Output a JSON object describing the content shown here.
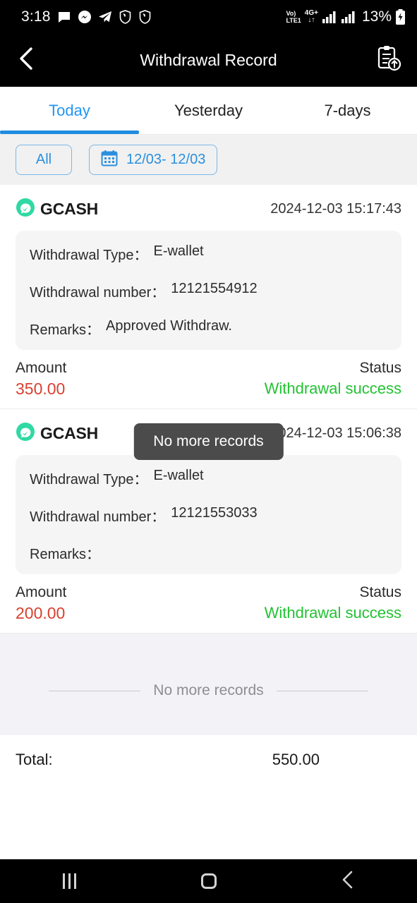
{
  "status_bar": {
    "clock": "3:18",
    "left_icons": [
      "message-bubble-icon",
      "messenger-icon",
      "telegram-icon",
      "shield-icon",
      "shield-icon"
    ],
    "volte_line1": "Vo)",
    "volte_line2": "LTE1",
    "network_type": "4G+",
    "data_arrows": "↓↑",
    "battery_percent": "13%",
    "battery_state": "charging"
  },
  "header": {
    "back_icon": "chevron-left-icon",
    "title": "Withdrawal Record",
    "action_icon": "clipboard-upload-icon"
  },
  "tabs": [
    {
      "label": "Today",
      "active": true
    },
    {
      "label": "Yesterday",
      "active": false
    },
    {
      "label": "7-days",
      "active": false
    }
  ],
  "filters": {
    "all_label": "All",
    "calendar_icon": "calendar-icon",
    "date_range": "12/03- 12/03"
  },
  "records": [
    {
      "brand": "GCASH",
      "brand_icon": "gcash-logo-icon",
      "timestamp": "2024-12-03 15:17:43",
      "type_label": "Withdrawal Type：",
      "type_value": "E-wallet",
      "number_label": "Withdrawal number：",
      "number_value": "12121554912",
      "remarks_label": "Remarks：",
      "remarks_value": "Approved Withdraw.",
      "amount_label": "Amount",
      "amount_value": "350.00",
      "status_label": "Status",
      "status_value": "Withdrawal success"
    },
    {
      "brand": "GCASH",
      "brand_icon": "gcash-logo-icon",
      "timestamp": "2024-12-03 15:06:38",
      "type_label": "Withdrawal Type：",
      "type_value": "E-wallet",
      "number_label": "Withdrawal number：",
      "number_value": "12121553033",
      "remarks_label": "Remarks：",
      "remarks_value": "",
      "amount_label": "Amount",
      "amount_value": "200.00",
      "status_label": "Status",
      "status_value": "Withdrawal success"
    }
  ],
  "toast": {
    "message": "No more records"
  },
  "footer": {
    "no_more_records": "No more records"
  },
  "total": {
    "label": "Total:",
    "value": "550.00"
  },
  "nav_bar": {
    "recents_icon": "recents-icon",
    "home_icon": "home-icon",
    "back_icon": "nav-back-icon"
  },
  "colors": {
    "accent_blue": "#1f8ce0",
    "tab_active": "#2196f3",
    "amount_red": "#d9402e",
    "status_green": "#23c233",
    "gcash_green": "#2fd9a3",
    "toast_bg": "#4b4b4b",
    "footer_bg": "#f2f2f7"
  }
}
